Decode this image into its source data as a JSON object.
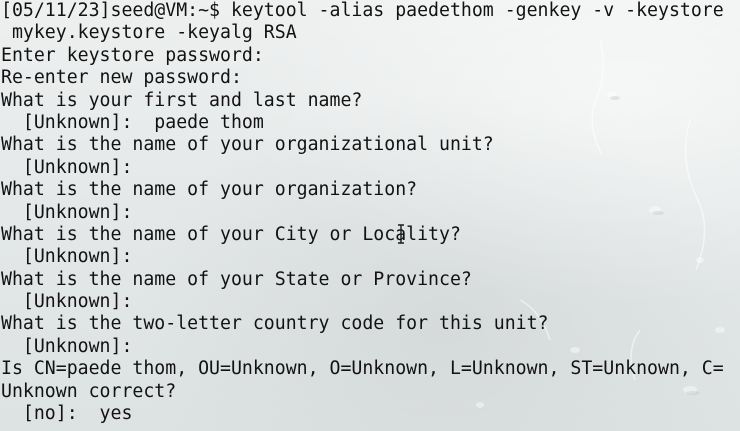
{
  "terminal": {
    "lines": [
      "[05/11/23]seed@VM:~$ keytool -alias paedethom -genkey -v -keystore",
      " mykey.keystore -keyalg RSA",
      "Enter keystore password:",
      "Re-enter new password:",
      "What is your first and last name?",
      "  [Unknown]:  paede thom",
      "What is the name of your organizational unit?",
      "  [Unknown]:",
      "What is the name of your organization?",
      "  [Unknown]:",
      "What is the name of your City or Locality?",
      "  [Unknown]:",
      "What is the name of your State or Province?",
      "  [Unknown]:",
      "What is the two-letter country code for this unit?",
      "  [Unknown]:",
      "Is CN=paede thom, OU=Unknown, O=Unknown, L=Unknown, ST=Unknown, C=",
      "Unknown correct?",
      "  [no]:  yes"
    ]
  }
}
